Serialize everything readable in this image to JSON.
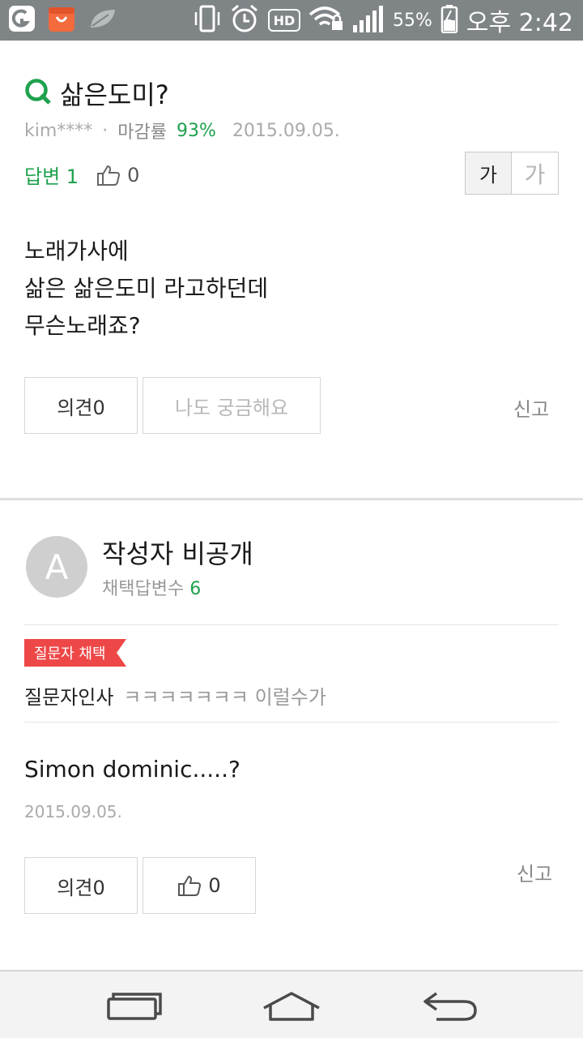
{
  "status_bar": {
    "battery_percent": "55%",
    "time": "오후 2:42",
    "hd_label": "HD"
  },
  "question": {
    "q_mark": "Q",
    "title": "삶은도미?",
    "author": "kim****",
    "dot": "·",
    "deadline_label": "마감률",
    "deadline_value": "93%",
    "date": "2015.09.05.",
    "answers_label": "답변 1",
    "like_count": "0",
    "font_small": "가",
    "font_large": "가",
    "body_lines": [
      "노래가사에",
      "삶은 삶은도미 라고하던데",
      "무슨노래죠?"
    ],
    "comment_button": "의견0",
    "curious_button": "나도 궁금해요",
    "report": "신고"
  },
  "answer": {
    "avatar_letter": "A",
    "author": "작성자 비공개",
    "adopt_label": "채택답변수",
    "adopt_count": "6",
    "badge": "질문자 채택",
    "thanks_label": "질문자인사",
    "thanks_message": "ㅋㅋㅋㅋㅋㅋㅋ 이럴수가",
    "body": "Simon dominic.....?",
    "date": "2015.09.05.",
    "comment_button": "의견0",
    "like_count": "0",
    "report": "신고"
  },
  "colors": {
    "accent_green": "#1ea14d",
    "badge_red": "#ee4747",
    "status_bar": "#7f8487"
  }
}
